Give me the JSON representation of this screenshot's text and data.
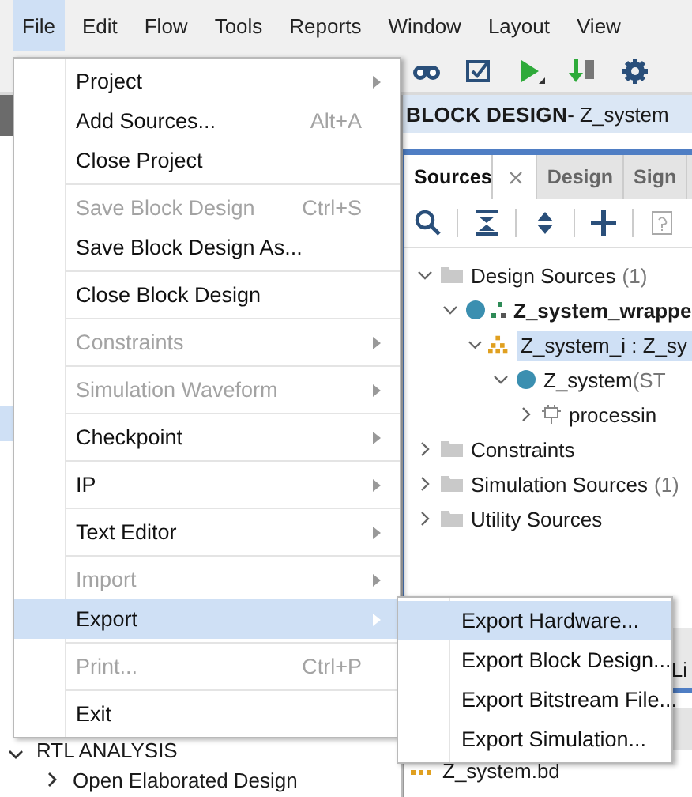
{
  "menubar": {
    "items": [
      {
        "label": "File",
        "selected": true
      },
      {
        "label": "Edit",
        "selected": false
      },
      {
        "label": "Flow",
        "selected": false
      },
      {
        "label": "Tools",
        "selected": false
      },
      {
        "label": "Reports",
        "selected": false
      },
      {
        "label": "Window",
        "selected": false
      },
      {
        "label": "Layout",
        "selected": false
      },
      {
        "label": "View",
        "selected": false
      }
    ]
  },
  "toolbar": {
    "items": [
      {
        "kind": "binoculars"
      },
      {
        "kind": "checkbox"
      },
      {
        "kind": "run"
      },
      {
        "kind": "bitstream"
      },
      {
        "kind": "settings"
      }
    ]
  },
  "flow_navigator": {
    "items": [
      {
        "label": "RTL ANALYSIS",
        "expanded": true,
        "children": [
          {
            "label": "Open Elaborated Design",
            "expanded": false
          }
        ]
      }
    ]
  },
  "block_design_header": {
    "title": "BLOCK DESIGN",
    "subtitle": " - Z_system"
  },
  "sources_panel": {
    "tabs": [
      {
        "label": "Sources",
        "selected": true,
        "closable": true
      },
      {
        "label": "Design",
        "selected": false,
        "closable": false
      },
      {
        "label": "Sign",
        "selected": false,
        "closable": false
      }
    ],
    "tools": [
      {
        "kind": "search"
      },
      {
        "kind": "collapse"
      },
      {
        "kind": "expand"
      },
      {
        "kind": "add"
      },
      {
        "kind": "help"
      }
    ],
    "tree": [
      {
        "label": "Design Sources",
        "count": "(1)",
        "kind": "folder",
        "expanded": true,
        "children": [
          {
            "label": "Z_system_wrappe",
            "kind": "wrapper",
            "bold": true,
            "expanded": true,
            "selected": false,
            "children": [
              {
                "label": "Z_system_i : Z_sy",
                "kind": "block",
                "expanded": true,
                "selected": true,
                "children": [
                  {
                    "label": "Z_system",
                    "detail": "(ST",
                    "kind": "module",
                    "expanded": true,
                    "children": [
                      {
                        "label": "processin",
                        "kind": "ip",
                        "expanded": false
                      }
                    ]
                  }
                ]
              }
            ]
          }
        ]
      },
      {
        "label": "Constraints",
        "kind": "folder",
        "expanded": false
      },
      {
        "label": "Simulation Sources",
        "count": "(1)",
        "kind": "folder",
        "expanded": false
      },
      {
        "label": "Utility Sources",
        "kind": "folder",
        "expanded": false
      }
    ]
  },
  "lower_panel": {
    "tab": "Li",
    "file": "Z_system.bd"
  },
  "file_menu": {
    "items": [
      {
        "kind": "item",
        "label": "Project",
        "submenu": true,
        "disabled": false,
        "selected": false
      },
      {
        "kind": "item",
        "label": "Add Sources...",
        "shortcut": "Alt+A",
        "disabled": false,
        "selected": false
      },
      {
        "kind": "item",
        "label": "Close Project",
        "disabled": false,
        "selected": false
      },
      {
        "kind": "separator"
      },
      {
        "kind": "item",
        "label": "Save Block Design",
        "shortcut": "Ctrl+S",
        "disabled": true,
        "selected": false
      },
      {
        "kind": "item",
        "label": "Save Block Design As...",
        "disabled": false,
        "selected": false
      },
      {
        "kind": "separator"
      },
      {
        "kind": "item",
        "label": "Close Block Design",
        "disabled": false,
        "selected": false
      },
      {
        "kind": "separator"
      },
      {
        "kind": "item",
        "label": "Constraints",
        "submenu": true,
        "disabled": true,
        "selected": false
      },
      {
        "kind": "separator"
      },
      {
        "kind": "item",
        "label": "Simulation Waveform",
        "submenu": true,
        "disabled": true,
        "selected": false
      },
      {
        "kind": "separator"
      },
      {
        "kind": "item",
        "label": "Checkpoint",
        "submenu": true,
        "disabled": false,
        "selected": false
      },
      {
        "kind": "separator"
      },
      {
        "kind": "item",
        "label": "IP",
        "submenu": true,
        "disabled": false,
        "selected": false
      },
      {
        "kind": "separator"
      },
      {
        "kind": "item",
        "label": "Text Editor",
        "submenu": true,
        "disabled": false,
        "selected": false
      },
      {
        "kind": "separator"
      },
      {
        "kind": "item",
        "label": "Import",
        "submenu": true,
        "disabled": true,
        "selected": false
      },
      {
        "kind": "item",
        "label": "Export",
        "submenu": true,
        "disabled": false,
        "selected": true
      },
      {
        "kind": "separator"
      },
      {
        "kind": "item",
        "label": "Print...",
        "shortcut": "Ctrl+P",
        "disabled": true,
        "selected": false
      },
      {
        "kind": "separator"
      },
      {
        "kind": "item",
        "label": "Exit",
        "disabled": false,
        "selected": false
      }
    ]
  },
  "export_submenu": {
    "items": [
      {
        "label": "Export Hardware...",
        "selected": true
      },
      {
        "label": "Export Block Design...",
        "selected": false
      },
      {
        "label": "Export Bitstream File...",
        "selected": false
      },
      {
        "label": "Export Simulation...",
        "selected": false
      }
    ]
  }
}
